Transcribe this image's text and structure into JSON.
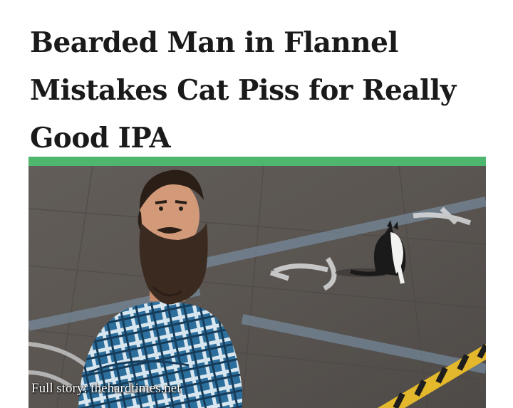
{
  "article": {
    "headline_lines": [
      "Bearded Man in Flannel",
      "Mistakes Cat Piss for Really",
      "Good IPA"
    ],
    "caption": "Full story: thehardtimes.net"
  },
  "colors": {
    "accent_bar": "#4fb76d",
    "headline_text": "#1a1a1a",
    "pavement": "#5e5955",
    "flannel_blue": "#2d6f9c"
  },
  "photo": {
    "subjects": [
      "bearded-man",
      "black-and-white-cat",
      "parking-lot"
    ]
  }
}
